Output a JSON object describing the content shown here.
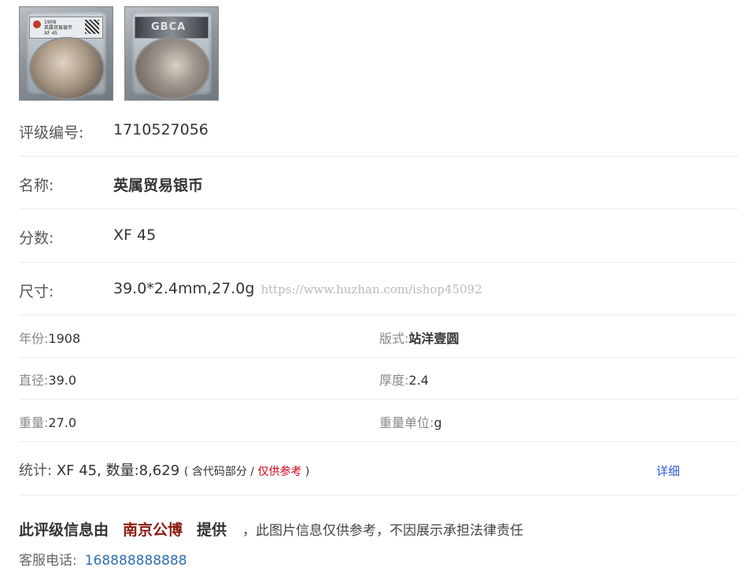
{
  "images": [
    {
      "name": "obverse-photo",
      "label_lines": [
        "1908",
        "英属贸易银币",
        "XF 45"
      ]
    },
    {
      "name": "reverse-photo",
      "label_text": "GBCA"
    }
  ],
  "grade_number": {
    "label": "评级编号:",
    "value": "1710527056"
  },
  "coin_name": {
    "label": "名称:",
    "value": "英属贸易银币"
  },
  "score": {
    "label": "分数:",
    "value": "XF 45"
  },
  "size": {
    "label": "尺寸:",
    "value": "39.0*2.4mm,27.0g",
    "watermark": "https://www.huzhan.com/ishop45092"
  },
  "attributes": [
    {
      "key": "年份:",
      "value": "1908"
    },
    {
      "key": "版式:",
      "value": "站洋壹圆"
    },
    {
      "key": "直径:",
      "value": "39.0"
    },
    {
      "key": "厚度:",
      "value": "2.4"
    },
    {
      "key": "重量:",
      "value": "27.0"
    },
    {
      "key": "重量单位:",
      "value": "g"
    }
  ],
  "stats": {
    "label": "统计:",
    "grade": "XF 45",
    "count_text": ", 数量:8,629",
    "note_open": "( 含代码部分 /",
    "note_red": "仅供参考",
    "note_close": ")",
    "detail_link": "详细"
  },
  "provider": {
    "prefix": "此评级信息由",
    "org": "南京公博",
    "suffix": "提供",
    "disclaimer": "，此图片信息仅供参考，不因展示承担法律责任"
  },
  "service_phone": {
    "label": "客服电话:",
    "number": "168888888888"
  },
  "colors": {
    "accent_red": "#d0021b",
    "org_red": "#8b1a10",
    "link_blue": "#2a5bd7",
    "phone_blue": "#2f6fb3"
  }
}
